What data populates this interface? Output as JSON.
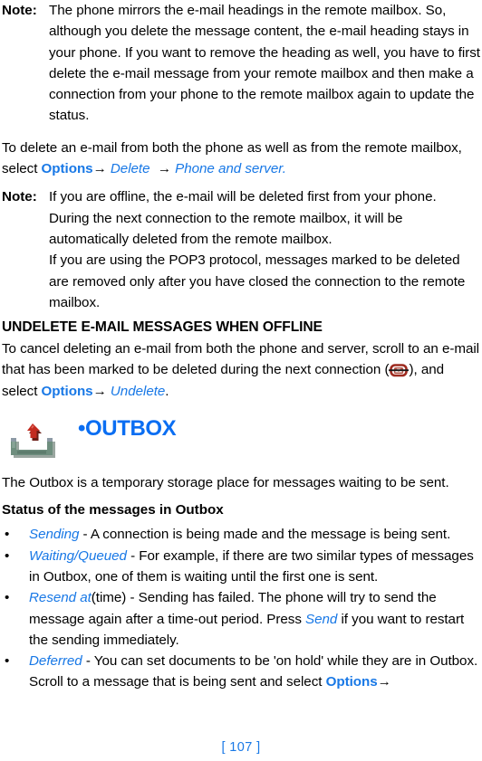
{
  "page": {
    "footer_label": "[ 107 ]",
    "accent_blue": "#1878E6",
    "heading_blue": "#0B6EF2",
    "icon_red": "#9E2B20",
    "icon_green": "#6E8E7E"
  },
  "note_label": "Note:",
  "arrow_glyph": "→",
  "bullet_glyph": "•",
  "note1": {
    "label": "Note:",
    "text": "The phone mirrors the e-mail headings in the remote mailbox. So, although you delete the message content, the e-mail heading stays in your phone. If you want to remove the heading as well, you have to first delete the e-mail message from your remote mailbox and then make a connection from your phone to the remote mailbox again to update the status."
  },
  "delete_para": {
    "part1": "To delete an e-mail from both the phone as well as from the remote mailbox, select ",
    "options_label": "Options",
    "arrow1": "→",
    "delete_label": "Delete",
    "arrow2": "→",
    "target_label": "Phone and server",
    "end": "."
  },
  "note2": {
    "label": "Note:",
    "line1": "If you are offline, the e-mail will be deleted first from your phone. During the next connection to the remote mailbox, it will be automatically deleted from the remote mailbox.",
    "line2": "If you are using the POP3 protocol, messages marked to be deleted are removed only after you have closed the connection to the remote mailbox."
  },
  "undelete_section": {
    "heading": "UNDELETE E-MAIL MESSAGES WHEN OFFLINE",
    "body_part1": "To cancel deleting an e-mail from both the phone and server, scroll to an e-mail that has been marked to be deleted during the next connection (",
    "icon_name": "deleted-mail-icon",
    "body_part2": "), and select ",
    "options_label": "Options",
    "arrow": "→",
    "undelete_label": "Undelete",
    "end": "."
  },
  "outbox_chapter": {
    "bullet": "•",
    "title": "OUTBOX",
    "icon_name": "outbox-tray-icon"
  },
  "outbox_intro": "The Outbox is a temporary storage place for messages waiting to be sent.",
  "status_heading": "Status of the messages in Outbox",
  "status_items": [
    {
      "term": "Sending",
      "term_suffix": "",
      "text": " - A connection is being made and the message is being sent."
    },
    {
      "term": "Waiting/Queued",
      "term_suffix": "",
      "text": " - For example, if there are two similar types of messages in Outbox, one of them is waiting until the first one is sent."
    },
    {
      "term": "Resend at",
      "term_suffix": "(time)",
      "text_a": " - Sending has failed. The phone will try to send the message again after a time-out period. Press ",
      "press_label": "Send",
      "text_b": " if you want to restart the sending immediately."
    },
    {
      "term": "Deferred",
      "term_suffix": "",
      "text_a": " - You can set documents to be 'on hold' while they are in Outbox. Scroll to a message that is being sent and select ",
      "options_label": "Options",
      "arrow": "→"
    }
  ]
}
